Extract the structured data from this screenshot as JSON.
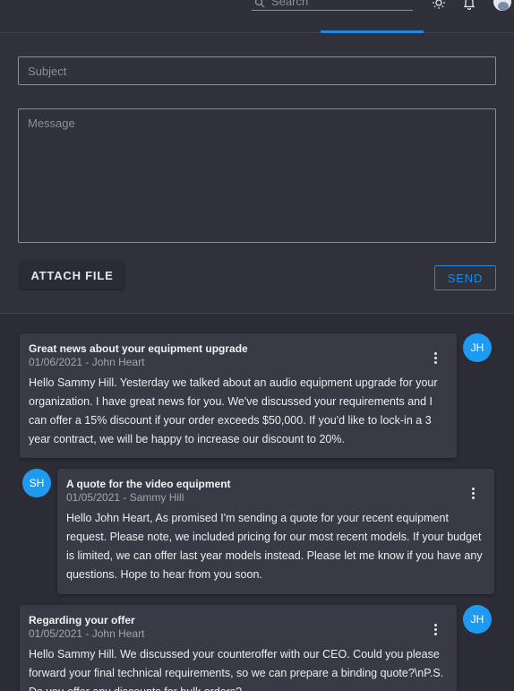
{
  "header": {
    "search_placeholder": "Search",
    "icons": [
      "search-icon",
      "brightness-icon",
      "bell-icon",
      "user-avatar"
    ],
    "accent": "#1e88e5"
  },
  "compose": {
    "subject_placeholder": "Subject",
    "message_placeholder": "Message",
    "attach_label": "ATTACH FILE",
    "send_label": "SEND"
  },
  "messages": [
    {
      "subject": "Great news about your equipment upgrade",
      "meta": "01/06/2021 - John Heart",
      "body": "Hello Sammy Hill. Yesterday we talked about an audio equipment upgrade for your organization. I have great news for you. We've discussed your requirements and I can offer a 15% discount if your order exceeds $50,000. If you'd like to lock-in a 3 year contract, we will be happy to increase our discount to 20%.",
      "initials": "JH"
    },
    {
      "subject": "A quote for the video equipment",
      "meta": "01/05/2021 - Sammy Hill",
      "body": "Hello John Heart, As promised I'm sending a quote for your recent equipment request. Please note, we included pricing for our most recent models. If your budget is limited, we can offer last year models instead. Please let me know if you have any questions. Hope to hear from you soon.",
      "initials": "SH"
    },
    {
      "subject": "Regarding your offer",
      "meta": "01/05/2021 - John Heart",
      "body": "Hello Sammy Hill. We discussed your counteroffer with our CEO. Could you please forward your final technical requirements, so we can prepare a binding quote?\\nP.S. Do you offer any discounts for bulk orders?",
      "initials": "JH"
    }
  ]
}
